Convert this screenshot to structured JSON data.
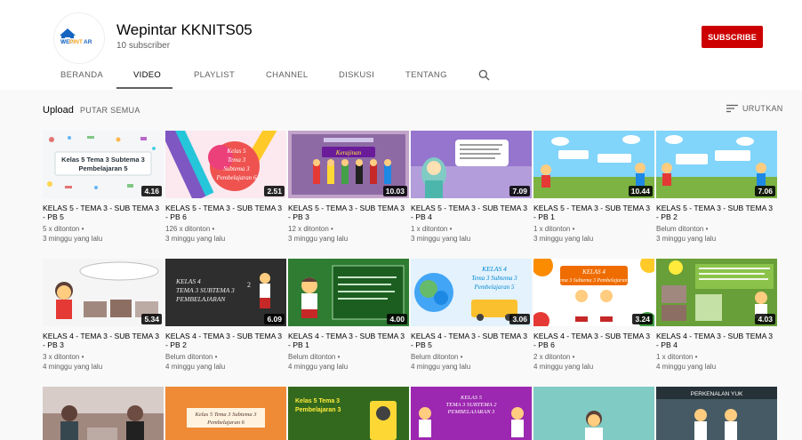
{
  "channel": {
    "name": "Wepintar KKNITS05",
    "subscribers": "10 subscriber",
    "logo_text": "WEPINTAR",
    "subscribe_label": "SUBSCRIBE"
  },
  "tabs": [
    "BERANDA",
    "VIDEO",
    "PLAYLIST",
    "CHANNEL",
    "DISKUSI",
    "TENTANG"
  ],
  "active_tab": "VIDEO",
  "section": {
    "title": "Upload",
    "play_all": "PUTAR SEMUA",
    "sort_label": "URUTKAN"
  },
  "colors": {
    "accent": "#cc0000",
    "background": "#f9f9f9"
  },
  "videos_row1": [
    {
      "title": "KELAS 5 - TEMA 3 - SUB TEMA 3 - PB 5",
      "views": "5 x ditonton •",
      "age": "3 minggu yang lalu",
      "duration": "4.16",
      "thumb_text": "Kelas 5 Tema 3 Subtema 3 Pembelajaran 5"
    },
    {
      "title": "KELAS 5 - TEMA 3 - SUB TEMA 3 - PB 6",
      "views": "126 x ditonton •",
      "age": "3 minggu yang lalu",
      "duration": "2.51",
      "thumb_text": "Kelas 5 Tema 3 Subtema 3 Pembelajaran 6"
    },
    {
      "title": "KELAS 5 - TEMA 3 - SUB TEMA 3 - PB 3",
      "views": "12 x ditonton •",
      "age": "3 minggu yang lalu",
      "duration": "10.03",
      "thumb_text": "Kerajinan"
    },
    {
      "title": "KELAS 5 - TEMA 3 - SUB TEMA 3 - PB 4",
      "views": "1 x ditonton •",
      "age": "3 minggu yang lalu",
      "duration": "7.09",
      "thumb_text": ""
    },
    {
      "title": "KELAS 5 - TEMA 3 - SUB TEMA 3 - PB 1",
      "views": "1 x ditonton •",
      "age": "3 minggu yang lalu",
      "duration": "10.44",
      "thumb_text": ""
    },
    {
      "title": "KELAS 5 - TEMA 3 - SUB TEMA 3 - PB 2",
      "views": "Belum ditonton •",
      "age": "3 minggu yang lalu",
      "duration": "7.06",
      "thumb_text": ""
    }
  ],
  "videos_row2": [
    {
      "title": "KELAS 4 - TEMA 3 - SUB TEMA 3 - PB 3",
      "views": "3 x ditonton •",
      "age": "4 minggu yang lalu",
      "duration": "5.34",
      "thumb_text": ""
    },
    {
      "title": "KELAS 4 - TEMA 3 - SUB TEMA 3 - PB 2",
      "views": "Belum ditonton •",
      "age": "4 minggu yang lalu",
      "duration": "6.09",
      "thumb_text": "KELAS 4 TEMA 3 SUBTEMA 3 PEMBELAJARAN 2"
    },
    {
      "title": "KELAS 4 - TEMA 3 - SUB TEMA 3 - PB 1",
      "views": "Belum ditonton •",
      "age": "4 minggu yang lalu",
      "duration": "4.00",
      "thumb_text": ""
    },
    {
      "title": "KELAS 4 - TEMA 3 - SUB TEMA 3 - PB 5",
      "views": "Belum ditonton •",
      "age": "4 minggu yang lalu",
      "duration": "3.06",
      "thumb_text": "KELAS 4 Tema 3 Subtema 3 Pembelajaran 5"
    },
    {
      "title": "KELAS 4 - TEMA 3 - SUB TEMA 3 - PB 6",
      "views": "2 x ditonton •",
      "age": "4 minggu yang lalu",
      "duration": "3.24",
      "thumb_text": "KELAS 4 Tema 3 Subtema 3 Pembelajaran 6"
    },
    {
      "title": "KELAS 4 - TEMA 3 - SUB TEMA 3 - PB 4",
      "views": "1 x ditonton •",
      "age": "4 minggu yang lalu",
      "duration": "4.03",
      "thumb_text": ""
    }
  ],
  "videos_row3": [
    {
      "thumb_text": ""
    },
    {
      "thumb_text": "Kelas 5 Tema 3 Subtema 3 Pembelajaran 6"
    },
    {
      "thumb_text": "Kelas 5 Tema 3 Pembelajaran 3"
    },
    {
      "thumb_text": "KELAS 5 TEMA 3 SUBTEMA 2 PEMBELAJARAN 3"
    },
    {
      "thumb_text": ""
    },
    {
      "thumb_text": "PERKENALAN YUK"
    }
  ]
}
